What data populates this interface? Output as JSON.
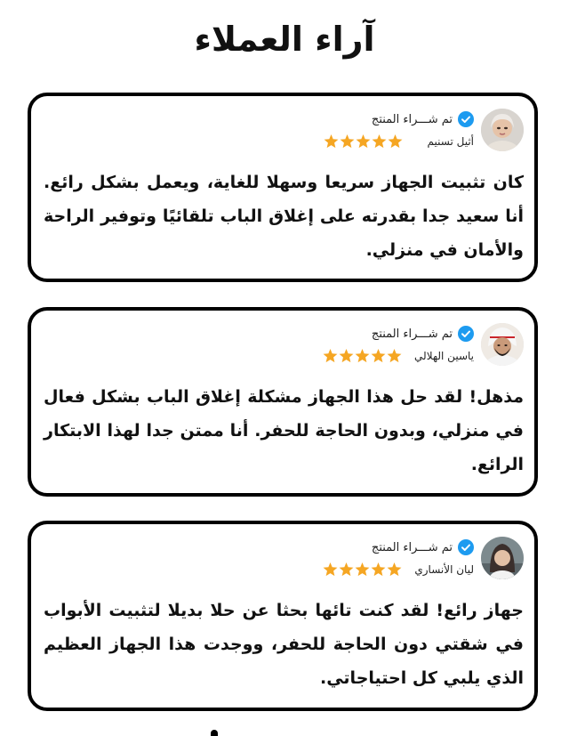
{
  "page": {
    "title": "آراء العملاء"
  },
  "icons": {
    "verified": "verified-check-icon",
    "star": "star-icon"
  },
  "colors": {
    "verified_blue": "#1d9bf0",
    "star_orange": "#f5a623",
    "border": "#000000"
  },
  "reviews": [
    {
      "reviewer": "أثيل تسنيم",
      "verified_label": "تم شـــراء المنتج",
      "rating": 5,
      "text": "كان تثبيت الجهاز سريعا وسهلا للغاية، ويعمل بشكل رائع. أنا سعيد جدا بقدرته على إغلاق الباب تلقائيًا وتوفير الراحة والأمان في منزلي."
    },
    {
      "reviewer": "ياسين الهلالي",
      "verified_label": "تم شـــراء المنتج",
      "rating": 5,
      "text": "مذهل! لقد حل هذا الجهاز مشكلة إغلاق الباب بشكل فعال في منزلي، وبدون الحاجة للحفر. أنا ممتن جدا لهذا الابتكار الرائع."
    },
    {
      "reviewer": "ليان الأنساري",
      "verified_label": "تم شـــراء المنتج",
      "rating": 5,
      "text": "جهاز رائع! لقد كنت تائها بحثا عن حلا بديلا لتثبيت الأبواب في شقتي دون الحاجة للحفر، ووجدت هذا الجهاز العظيم الذي يلبي كل احتياجاتي."
    }
  ]
}
